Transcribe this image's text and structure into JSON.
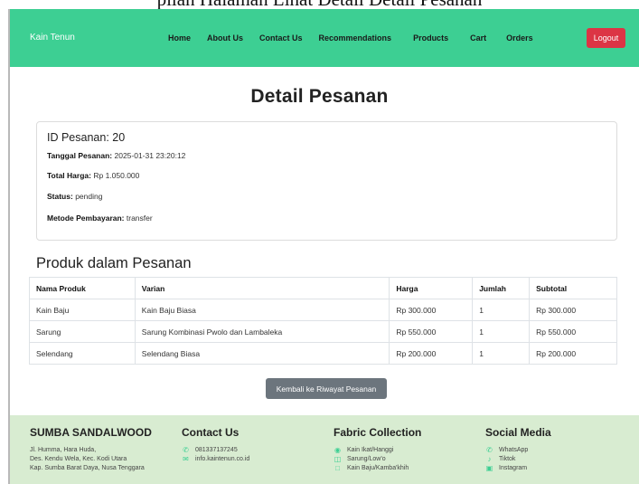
{
  "doc_heading": "pilan Halaman Lihat Detail Detail Pesanan",
  "navbar": {
    "brand": "Kain Tenun",
    "links": [
      "Home",
      "About Us",
      "Contact Us",
      "Recommendations",
      "Products",
      "Cart",
      "Orders"
    ],
    "logout": "Logout",
    "colors": {
      "bar": "#3dcf93",
      "logout": "#dc3545"
    }
  },
  "page": {
    "title": "Detail Pesanan",
    "order": {
      "id_text": "ID Pesanan: 20",
      "date_label": "Tanggal Pesanan:",
      "date_value": "2025-01-31 23:20:12",
      "total_label": "Total Harga:",
      "total_value": "Rp 1.050.000",
      "status_label": "Status:",
      "status_value": "pending",
      "payment_label": "Metode Pembayaran:",
      "payment_value": "transfer"
    },
    "products_title": "Produk dalam Pesanan",
    "table": {
      "headers": [
        "Nama Produk",
        "Varian",
        "Harga",
        "Jumlah",
        "Subtotal"
      ],
      "rows": [
        [
          "Kain Baju",
          "Kain Baju Biasa",
          "Rp 300.000",
          "1",
          "Rp 300.000"
        ],
        [
          "Sarung",
          "Sarung Kombinasi Pwolo dan Lambaleka",
          "Rp 550.000",
          "1",
          "Rp 550.000"
        ],
        [
          "Selendang",
          "Selendang Biasa",
          "Rp 200.000",
          "1",
          "Rp 200.000"
        ]
      ]
    },
    "back_button": "Kembali ke Riwayat Pesanan"
  },
  "footer": {
    "about": {
      "title": "SUMBA SANDALWOOD",
      "lines": [
        "Jl. Humma, Hara Huda,",
        "Des. Kendu Wela, Kec. Kodi Utara",
        "Kap. Sumba Barat Daya, Nusa Tenggara"
      ]
    },
    "contact": {
      "title": "Contact Us",
      "items": [
        {
          "icon": "phone-icon",
          "text": "081337137245"
        },
        {
          "icon": "mail-icon",
          "text": "info.kaintenun.co.id"
        }
      ]
    },
    "fabric": {
      "title": "Fabric Collection",
      "items": [
        {
          "icon": "globe-icon",
          "text": "Kain Ikat/Hanggi"
        },
        {
          "icon": "book-icon",
          "text": "Sarung/Low'o"
        },
        {
          "icon": "square-icon",
          "text": "Kain Baju/Kamba'khih"
        }
      ]
    },
    "social": {
      "title": "Social Media",
      "items": [
        {
          "icon": "whatsapp-icon",
          "text": "WhatsApp"
        },
        {
          "icon": "tiktok-icon",
          "text": "Tiktok"
        },
        {
          "icon": "instagram-icon",
          "text": "Instagram"
        }
      ]
    }
  }
}
